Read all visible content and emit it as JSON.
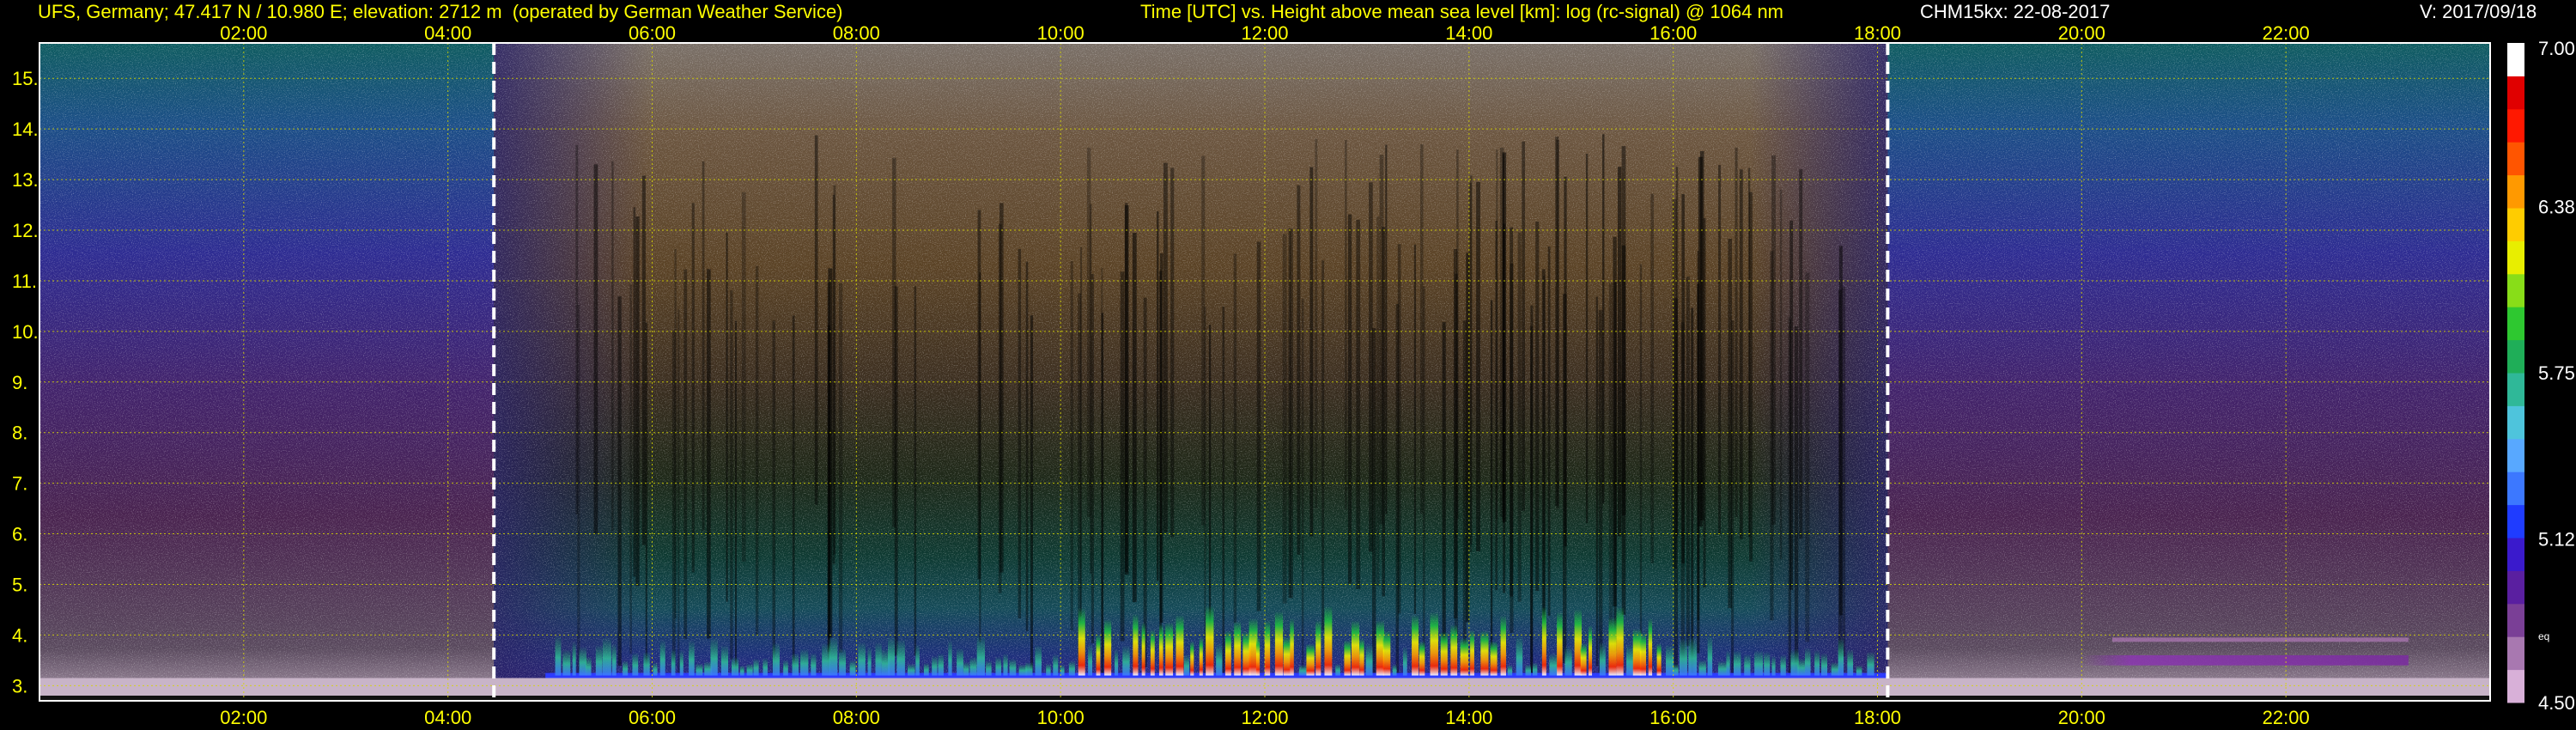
{
  "header": {
    "station": "UFS, Germany; 47.417 N / 10.980 E; elevation: 2712 m  (operated by German Weather Service)",
    "axes_title": "Time [UTC] vs. Height above mean sea level [km]: log (rc-signal) @ 1064 nm",
    "instrument_date": "CHM15kx: 22-08-2017",
    "version": "V: 2017/09/18"
  },
  "colors": {
    "header_text": "#ffff00",
    "tick_text": "#ffff00",
    "grid": "#d8d800",
    "frame": "#ffffff",
    "sun_markers": "#ffffff",
    "background": "#000000"
  },
  "chart_data": {
    "type": "heatmap",
    "title": "Time [UTC] vs. Height above mean sea level [km]: log (rc-signal) @ 1064 nm",
    "x_tick_labels": [
      "02:00",
      "04:00",
      "06:00",
      "08:00",
      "10:00",
      "12:00",
      "14:00",
      "16:00",
      "18:00",
      "20:00",
      "22:00"
    ],
    "x_ticks_hours": [
      2,
      4,
      6,
      8,
      10,
      12,
      14,
      16,
      18,
      20,
      22
    ],
    "x_range_hours": [
      0,
      24
    ],
    "y_tick_labels": [
      "3.",
      "4.",
      "5.",
      "6.",
      "7.",
      "8.",
      "9.",
      "10.",
      "11.",
      "12.",
      "13.",
      "14.",
      "15."
    ],
    "y_ticks_km": [
      3,
      4,
      5,
      6,
      7,
      8,
      9,
      10,
      11,
      12,
      13,
      14,
      15
    ],
    "y_range_km": [
      2.7,
      15.7
    ],
    "grid": true,
    "sunrise_utc_hours": 4.45,
    "sunset_utc_hours": 18.1,
    "colorbar": {
      "range": [
        4.5,
        7.0
      ],
      "tick_labels": [
        "7.00",
        "6.38",
        "5.75",
        "5.12",
        "4.50"
      ],
      "tick_values": [
        7.0,
        6.38,
        5.75,
        5.12,
        4.5
      ],
      "unit_label": "eq",
      "colors": [
        "#d8b0d8",
        "#a878b0",
        "#7a3f96",
        "#5a1fa0",
        "#3a1acc",
        "#1f3cff",
        "#3c78ff",
        "#58a8ff",
        "#4ec4dc",
        "#2fb898",
        "#1fae58",
        "#2ec830",
        "#88dd18",
        "#e8ee00",
        "#ffcc00",
        "#ff9900",
        "#ff5500",
        "#ff1800",
        "#e00000",
        "#ffffff"
      ]
    },
    "features": {
      "boundary_layer_top_km": 3.15,
      "convective_plumes_km": [
        3.2,
        4.4
      ],
      "night_layer_km": [
        3.4,
        3.6
      ],
      "night_layer_hours": [
        20.0,
        23.2
      ]
    }
  }
}
